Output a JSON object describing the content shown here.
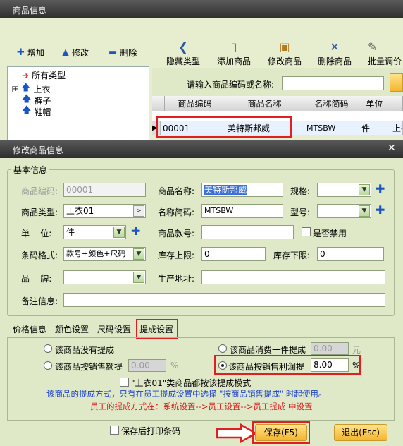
{
  "bg_window": {
    "title": "商品信息"
  },
  "toolbar_small": {
    "add": "增加",
    "edit": "修改",
    "delete": "删除"
  },
  "toolbar_big": {
    "hide_type": "隐藏类型",
    "add_goods": "添加商品",
    "edit_goods": "修改商品",
    "delete_goods": "删除商品",
    "batch_price": "批量调价"
  },
  "tree": {
    "root": "所有类型",
    "items": [
      "上衣",
      "裤子",
      "鞋帽"
    ]
  },
  "search": {
    "label": "请输入商品编码或名称:"
  },
  "grid": {
    "headers": [
      "商品编码",
      "商品名称",
      "名称简码",
      "单位"
    ],
    "row": {
      "code": "00001",
      "name": "美特斯邦威",
      "abbr": "MTSBW",
      "unit": "件",
      "extra": "上衣"
    }
  },
  "dialog": {
    "title": "修改商品信息",
    "group_title": "基本信息",
    "labels": {
      "code": "商品编码:",
      "name": "商品名称:",
      "spec": "规格:",
      "type": "商品类型:",
      "abbr": "名称简码:",
      "model": "型号:",
      "unit": "单    位:",
      "style_no": "商品款号:",
      "disabled": "是否禁用",
      "barcode": "条码格式:",
      "stock_max": "库存上限:",
      "stock_min": "库存下限:",
      "brand": "品    牌:",
      "address": "生产地址:",
      "remark": "备注信息:"
    },
    "values": {
      "code": "00001",
      "name": "美特斯邦威",
      "spec": "",
      "type": "上衣01",
      "abbr": "MTSBW",
      "model": "",
      "unit": "件",
      "style_no": "",
      "barcode": "款号+颜色+尺码",
      "stock_max": "0",
      "stock_min": "0",
      "brand": "",
      "address": "",
      "remark": ""
    },
    "tabs": [
      "价格信息",
      "颜色设置",
      "尺码设置",
      "提成设置"
    ],
    "commission": {
      "none": "该商品没有提成",
      "per_item": "该商品消费一件提成",
      "per_item_value": "0.00",
      "per_item_unit": "元",
      "by_sales": "该商品按销售额提",
      "by_sales_value": "0.00",
      "by_sales_unit": "%",
      "by_profit": "该商品按销售利润提",
      "by_profit_value": "8.00",
      "by_profit_unit": "%",
      "apply_all": "\"上衣01\"类商品都按该提成模式",
      "note1": "该商品的提成方式，只有在员工提成设置中选择 \"按商品销售提成\" 时起使用。",
      "note2": "员工的提成方式在：系统设置-->员工设置-->员工提成 中设置"
    },
    "print_after_save": "保存后打印条码",
    "save": "保存(F5)",
    "exit": "退出(Esc)"
  },
  "colors": {
    "note_blue": "#1a3fd0",
    "note_red": "#d81818",
    "highlight": "#e02020"
  }
}
